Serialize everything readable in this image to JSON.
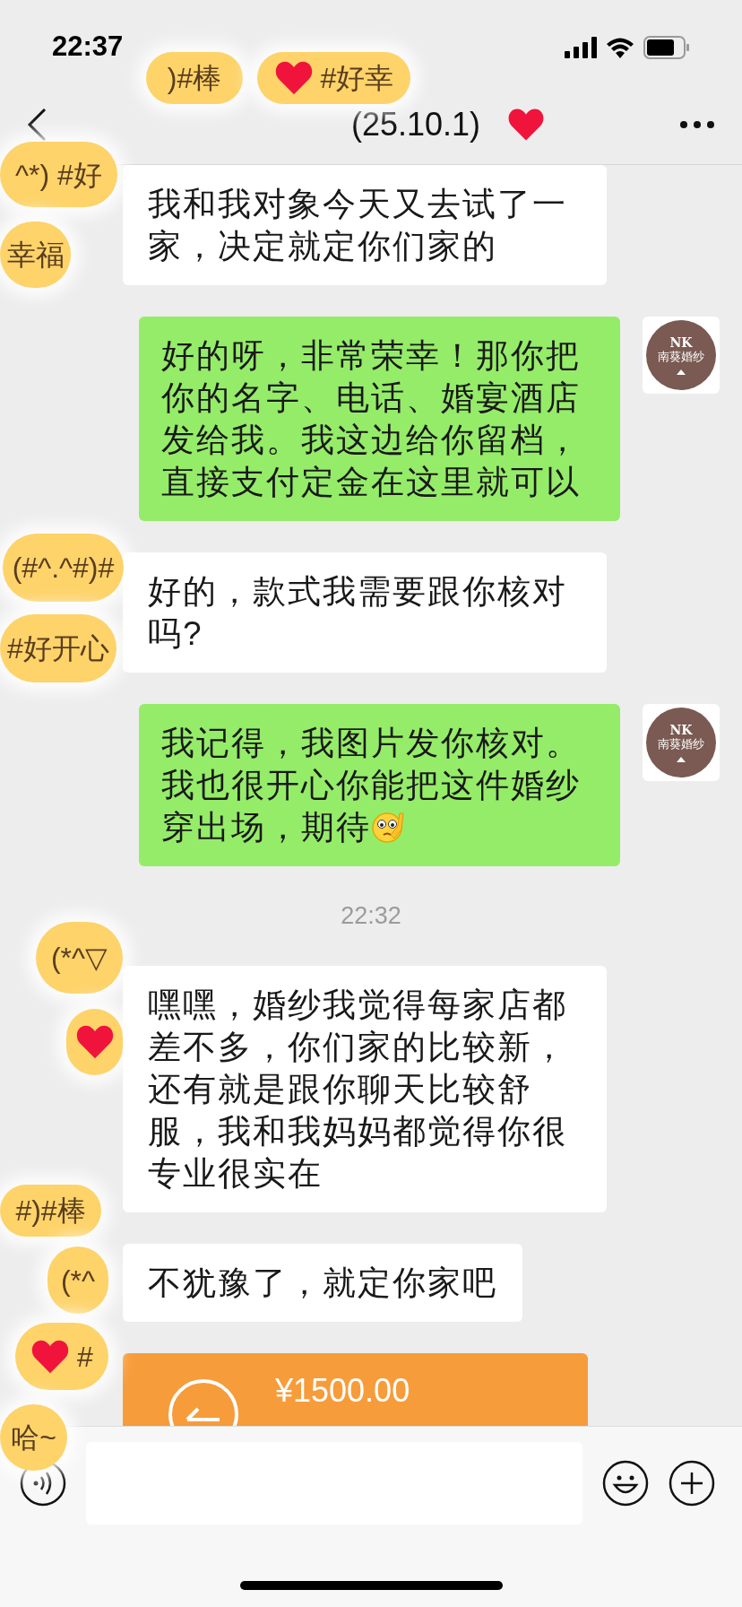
{
  "status_bar": {
    "time": "22:37"
  },
  "header": {
    "title": "(25.10.1)"
  },
  "messages": [
    {
      "kind": "incoming",
      "text": "我和我对象今天又去试了一家，决定就定你们家的"
    },
    {
      "kind": "outgoing",
      "text": "好的呀，非常荣幸！那你把你的名字、电话、婚宴酒店发给我。我这边给你留档，直接支付定金在这里就可以",
      "avatar": {
        "logo": "NK",
        "name": "南葵婚纱"
      }
    },
    {
      "kind": "incoming",
      "text": "好的，款式我需要跟你核对吗?"
    },
    {
      "kind": "outgoing",
      "text": "我记得，我图片发你核对。我也很开心你能把这件婚纱穿出场，期待",
      "emoji": true,
      "avatar": {
        "logo": "NK",
        "name": "南葵婚纱"
      }
    },
    {
      "kind": "time",
      "text": "22:32"
    },
    {
      "kind": "incoming",
      "text": "嘿嘿，婚纱我觉得每家店都差不多，你们家的比较新，还有就是跟你聊天比较舒服，我和我妈妈都觉得你很专业很实在"
    },
    {
      "kind": "incoming",
      "text": "不犹豫了，就定你家吧"
    },
    {
      "kind": "transfer",
      "amount": "¥1500.00"
    }
  ],
  "stickers": [
    {
      "text": ")#棒",
      "heart": false
    },
    {
      "text": "#好幸",
      "heart": true
    },
    {
      "text": "^*) #好",
      "heart": false
    },
    {
      "text": "幸福",
      "heart": false
    },
    {
      "text": "(#^.^#)#",
      "heart": false
    },
    {
      "text": "#好开心",
      "heart": false
    },
    {
      "text": "(*^▽",
      "heart": false
    },
    {
      "heart": true
    },
    {
      "text": "#)#棒",
      "heart": false
    },
    {
      "text": "(*^",
      "heart": false
    },
    {
      "text": "#",
      "heart": true
    },
    {
      "text": "哈~",
      "heart": false
    }
  ]
}
